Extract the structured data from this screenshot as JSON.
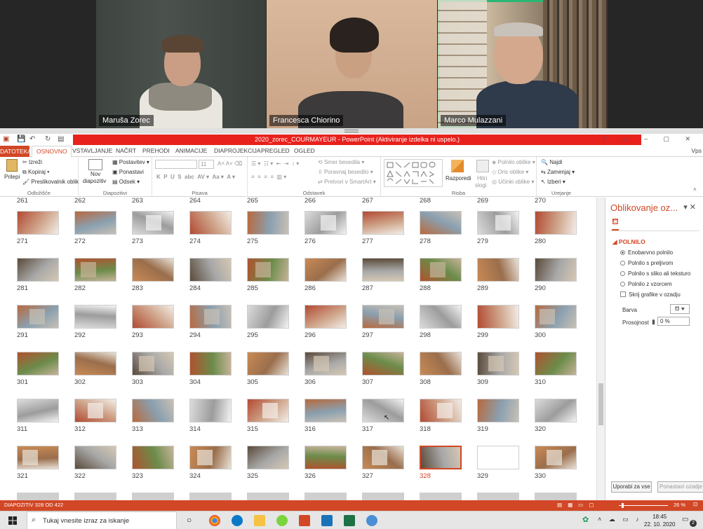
{
  "participants": [
    {
      "name": "Maruša Zorec",
      "active": false
    },
    {
      "name": "Francesca Chiorino",
      "active": false
    },
    {
      "name": "Marco Mulazzani",
      "active": true
    }
  ],
  "window": {
    "title": "2020_zorec_COURMAYEUR - PowerPoint (Aktiviranje izdelka ni uspelo.)",
    "user": "Vps"
  },
  "tabs": {
    "file": "DATOTEKA",
    "items": [
      "OSNOVNO",
      "VSTAVLJANJE",
      "NAČRT",
      "PREHODI",
      "ANIMACIJE",
      "DIAPROJEKCIJA",
      "PREGLED",
      "OGLED"
    ]
  },
  "ribbon": {
    "clipboard": {
      "paste": "Prilepi",
      "cut": "Izreži",
      "copy": "Kopiraj",
      "painter": "Preslikovalnik oblik",
      "group": "Odložišče"
    },
    "slides": {
      "new1": "Nov",
      "new2": "diapozitiv",
      "layout": "Postavitev",
      "reset": "Ponastavi",
      "section": "Odsek",
      "group": "Diapozitivi"
    },
    "font": {
      "size": "11",
      "group": "Pisava"
    },
    "paragraph": {
      "direction": "Smer besedila",
      "align": "Poravnaj besedilo",
      "smartart": "Pretvori v SmartArt",
      "group": "Odstavek"
    },
    "drawing": {
      "arrange": "Razporedi",
      "quick1": "Hitri",
      "quick2": "slogi",
      "fill": "Polnilo oblike",
      "outline": "Oris oblike",
      "effects": "Učinki oblike",
      "group": "Risba"
    },
    "editing": {
      "find": "Najdi",
      "replace": "Zamenjaj",
      "select": "Izberi",
      "group": "Urejanje"
    }
  },
  "sorter": {
    "top_numbers": [
      "261",
      "262",
      "263",
      "264",
      "265",
      "266",
      "267",
      "268",
      "269",
      "270"
    ],
    "rows": [
      [
        "271",
        "272",
        "273",
        "274",
        "275",
        "276",
        "277",
        "278",
        "279",
        "280"
      ],
      [
        "281",
        "282",
        "283",
        "284",
        "285",
        "286",
        "287",
        "288",
        "289",
        "290"
      ],
      [
        "291",
        "292",
        "293",
        "294",
        "295",
        "296",
        "297",
        "298",
        "299",
        "300"
      ],
      [
        "301",
        "302",
        "303",
        "304",
        "305",
        "306",
        "307",
        "308",
        "309",
        "310"
      ],
      [
        "311",
        "312",
        "313",
        "314",
        "315",
        "316",
        "317",
        "318",
        "319",
        "320"
      ],
      [
        "321",
        "322",
        "323",
        "324",
        "325",
        "326",
        "327",
        "328",
        "329",
        "330"
      ]
    ],
    "selected": "328"
  },
  "pane": {
    "title": "Oblikovanje oz...",
    "section": "POLNILO",
    "options": [
      "Enobarvno polnilo",
      "Polnilo s preljivom",
      "Polnilo s sliko ali teksturo",
      "Polnilo z vzorcem"
    ],
    "hide_bg": "Skrij grafike v ozadju",
    "color_label": "Barva",
    "transparency_label": "Prosojnost",
    "transparency_value": "0 %",
    "apply_all": "Uporabi za vse",
    "reset_bg": "Ponastavi ozadje"
  },
  "status": {
    "slide": "DIAPOZITIV 328 OD 422",
    "zoom": "26 %"
  },
  "taskbar": {
    "search_placeholder": "Tukaj vnesite izraz za iskanje",
    "time": "18:45",
    "date": "22. 10. 2020",
    "notifications": "2"
  },
  "colors": {
    "accent": "#d24726",
    "title_red": "#e8211d",
    "active_speaker": "#2bb673"
  }
}
